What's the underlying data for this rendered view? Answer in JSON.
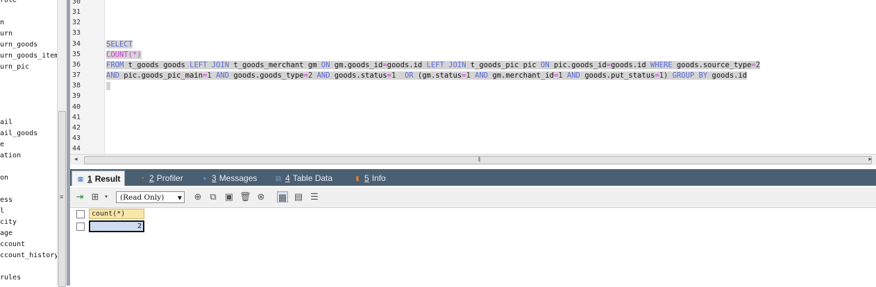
{
  "object_tree": {
    "items": [
      "role",
      "n",
      "urn",
      "urn_goods",
      "urn_goods_item",
      "urn_pic",
      "ail",
      "ail_goods",
      "e",
      "ation",
      "on",
      "ess",
      "l",
      "city",
      "age",
      "ccount",
      "ccount_history",
      "rules"
    ]
  },
  "editor": {
    "line_numbers": [
      "30",
      "31",
      "32",
      "33",
      "34",
      "35",
      "36",
      "37",
      "38",
      "39",
      "40",
      "41",
      "42",
      "43",
      "44"
    ],
    "lines": [
      [],
      [],
      [],
      [],
      [
        {
          "t": "SELECT",
          "c": "kw"
        }
      ],
      [
        {
          "t": "COUNT",
          "c": "fn"
        },
        {
          "t": "(*)",
          "c": "op"
        }
      ],
      [
        {
          "t": "FROM",
          "c": "kw"
        },
        {
          "t": " t_goods goods ",
          "c": "tx"
        },
        {
          "t": "LEFT JOIN",
          "c": "kw"
        },
        {
          "t": " t_goods_merchant gm ",
          "c": "tx"
        },
        {
          "t": "ON",
          "c": "kw"
        },
        {
          "t": " gm.goods_id",
          "c": "tx"
        },
        {
          "t": "=",
          "c": "op"
        },
        {
          "t": "goods.id ",
          "c": "tx"
        },
        {
          "t": "LEFT JOIN",
          "c": "kw"
        },
        {
          "t": " t_goods_pic pic ",
          "c": "tx"
        },
        {
          "t": "ON",
          "c": "kw"
        },
        {
          "t": " pic.goods_id",
          "c": "tx"
        },
        {
          "t": "=",
          "c": "op"
        },
        {
          "t": "goods.id ",
          "c": "tx"
        },
        {
          "t": "WHERE",
          "c": "kw"
        },
        {
          "t": " goods.source_type",
          "c": "tx"
        },
        {
          "t": "=",
          "c": "op"
        },
        {
          "t": "2",
          "c": "num"
        }
      ],
      [
        {
          "t": "AND",
          "c": "kw"
        },
        {
          "t": " pic.goods_pic_main",
          "c": "tx"
        },
        {
          "t": "=",
          "c": "op"
        },
        {
          "t": "1 ",
          "c": "num"
        },
        {
          "t": "AND",
          "c": "kw"
        },
        {
          "t": " goods.goods_type",
          "c": "tx"
        },
        {
          "t": "=",
          "c": "op"
        },
        {
          "t": "2 ",
          "c": "num"
        },
        {
          "t": "AND",
          "c": "kw"
        },
        {
          "t": " goods.status",
          "c": "tx"
        },
        {
          "t": "=",
          "c": "op"
        },
        {
          "t": "1  ",
          "c": "num"
        },
        {
          "t": "OR",
          "c": "kw"
        },
        {
          "t": " (gm.status",
          "c": "tx"
        },
        {
          "t": "=",
          "c": "op"
        },
        {
          "t": "1 ",
          "c": "num"
        },
        {
          "t": "AND",
          "c": "kw"
        },
        {
          "t": " gm.merchant_id",
          "c": "tx"
        },
        {
          "t": "=",
          "c": "op"
        },
        {
          "t": "1 ",
          "c": "num"
        },
        {
          "t": "AND",
          "c": "kw"
        },
        {
          "t": " goods.put_status",
          "c": "tx"
        },
        {
          "t": "=",
          "c": "op"
        },
        {
          "t": "1) ",
          "c": "num"
        },
        {
          "t": "GROUP BY",
          "c": "kw"
        },
        {
          "t": " goods.id",
          "c": "tx"
        }
      ],
      [
        {
          "t": " ",
          "c": "tx"
        }
      ],
      [],
      [],
      [],
      [],
      [],
      []
    ],
    "selected_lines": [
      4,
      5,
      6,
      7,
      8
    ]
  },
  "result_tabs": [
    {
      "num": "1",
      "label": "Result",
      "icon": "result-grid-icon",
      "active": true
    },
    {
      "num": "2",
      "label": "Profiler",
      "icon": "profiler-icon",
      "active": false
    },
    {
      "num": "3",
      "label": "Messages",
      "icon": "messages-icon",
      "active": false
    },
    {
      "num": "4",
      "label": "Table Data",
      "icon": "table-data-icon",
      "active": false
    },
    {
      "num": "5",
      "label": "Info",
      "icon": "info-icon",
      "active": false
    }
  ],
  "toolbar": {
    "mode_select": "(Read Only)"
  },
  "result_grid": {
    "columns": [
      "count(*)"
    ],
    "rows": [
      [
        "2"
      ]
    ]
  },
  "colors": {
    "tabs_bar": "#4b5f73",
    "keyword": "#5b6bd8",
    "function": "#d03ad0",
    "selection": "#d4d4d4",
    "header_cell": "#f7e7a8",
    "selected_cell": "#cfdcef"
  }
}
